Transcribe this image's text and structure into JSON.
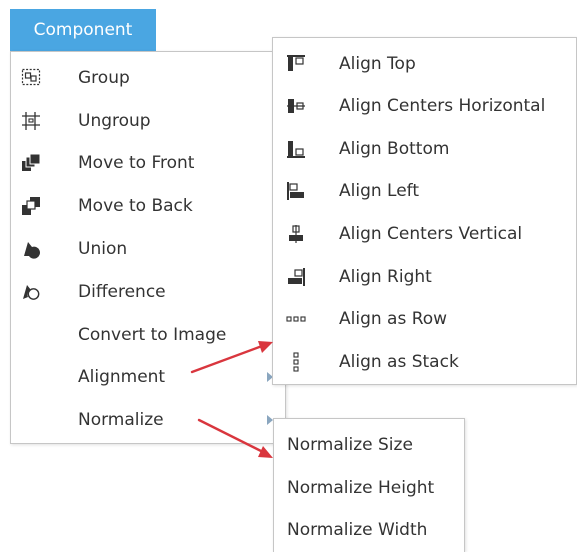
{
  "header": {
    "title": "Component"
  },
  "main_menu": {
    "items": [
      {
        "label": "Group",
        "icon": "group-icon"
      },
      {
        "label": "Ungroup",
        "icon": "ungroup-icon"
      },
      {
        "label": "Move to Front",
        "icon": "move-to-front-icon"
      },
      {
        "label": "Move to Back",
        "icon": "move-to-back-icon"
      },
      {
        "label": "Union",
        "icon": "union-icon"
      },
      {
        "label": "Difference",
        "icon": "difference-icon"
      },
      {
        "label": "Convert to Image",
        "icon": ""
      },
      {
        "label": "Alignment",
        "icon": "",
        "has_submenu": true
      },
      {
        "label": "Normalize",
        "icon": "",
        "has_submenu": true
      }
    ]
  },
  "alignment_submenu": {
    "items": [
      {
        "label": "Align Top",
        "icon": "align-top-icon"
      },
      {
        "label": "Align Centers Horizontal",
        "icon": "align-centers-horizontal-icon"
      },
      {
        "label": "Align Bottom",
        "icon": "align-bottom-icon"
      },
      {
        "label": "Align Left",
        "icon": "align-left-icon"
      },
      {
        "label": "Align Centers Vertical",
        "icon": "align-centers-vertical-icon"
      },
      {
        "label": "Align Right",
        "icon": "align-right-icon"
      },
      {
        "label": "Align as Row",
        "icon": "align-as-row-icon"
      },
      {
        "label": "Align as Stack",
        "icon": "align-as-stack-icon"
      }
    ]
  },
  "normalize_submenu": {
    "items": [
      {
        "label": "Normalize Size"
      },
      {
        "label": "Normalize Height"
      },
      {
        "label": "Normalize Width"
      }
    ]
  },
  "colors": {
    "header_bg": "#4aa6e2",
    "header_text": "#ffffff",
    "menu_text": "#333333",
    "icon": "#333333",
    "chevron": "#8aa6bf",
    "annotation_arrow": "#d9363e",
    "border": "#c6c6c6"
  }
}
